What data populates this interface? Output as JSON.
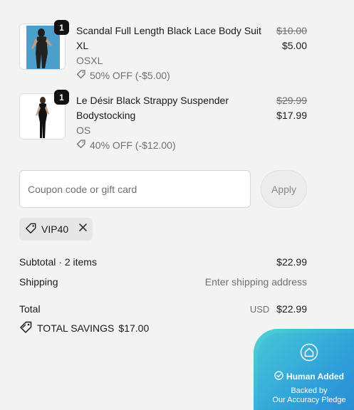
{
  "items": [
    {
      "quantity": "1",
      "title": "Scandal Full Length Black Lace Body Suit XL",
      "variant": "OSXL",
      "discount": "50% OFF (-$5.00)",
      "original_price": "$10.00",
      "price": "$5.00"
    },
    {
      "quantity": "1",
      "title": "Le Désir Black Strappy Suspender Bodystocking",
      "variant": "OS",
      "discount": "40% OFF (-$12.00)",
      "original_price": "$29.99",
      "price": "$17.99"
    }
  ],
  "coupon": {
    "placeholder": "Coupon code or gift card",
    "value": "",
    "apply_label": "Apply"
  },
  "applied_code": "VIP40",
  "summary": {
    "subtotal_label": "Subtotal · 2 items",
    "subtotal_value": "$22.99",
    "shipping_label": "Shipping",
    "shipping_value": "Enter shipping address",
    "total_label": "Total",
    "total_currency": "USD",
    "total_value": "$22.99",
    "savings_label": "TOTAL SAVINGS",
    "savings_value": "$17.00"
  },
  "badge": {
    "title": "Human Added",
    "line1": "Backed by",
    "line2": "Our Accuracy Pledge"
  },
  "colors": {
    "background": "#f3f3f3",
    "badge_gradient_start": "#4fd3d6",
    "badge_gradient_end": "#2b8fd6"
  },
  "icons": [
    "tag-icon",
    "close-icon",
    "house-icon",
    "check-badge-icon"
  ]
}
